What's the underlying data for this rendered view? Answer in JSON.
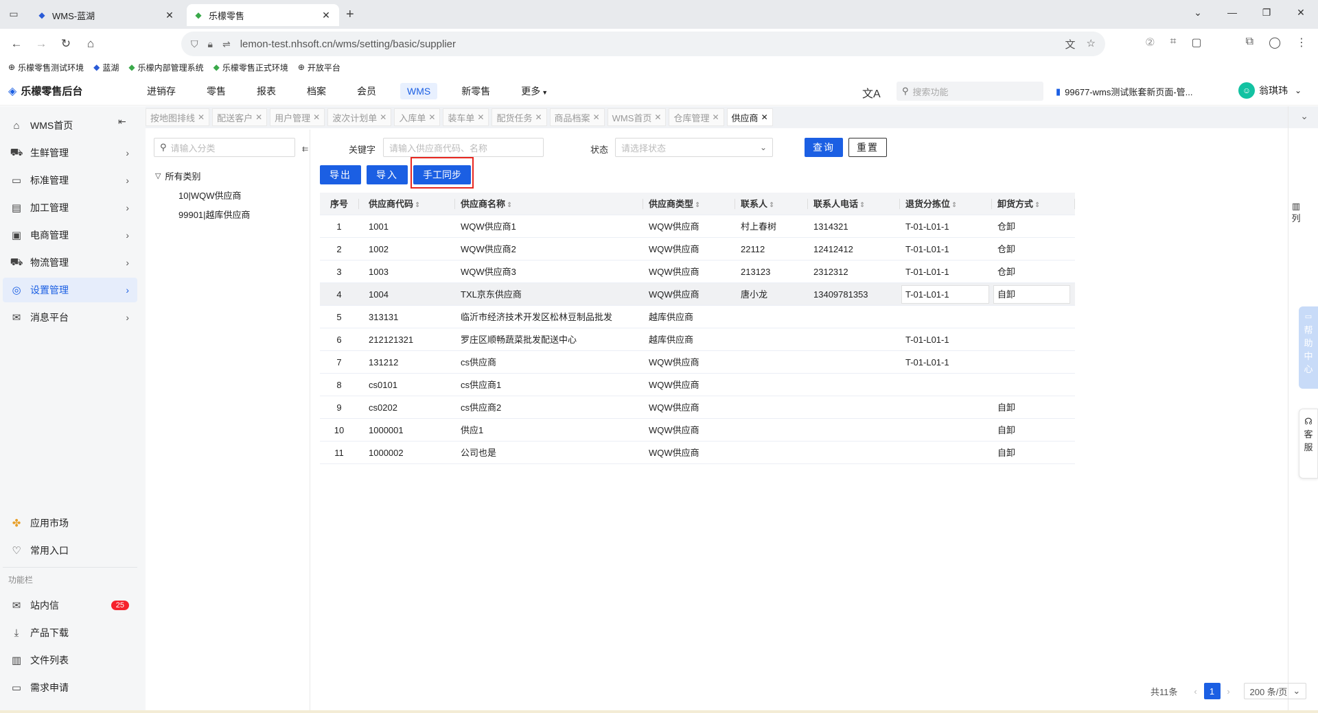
{
  "browser": {
    "tabs": [
      {
        "title": "WMS-蓝湖",
        "active": false
      },
      {
        "title": "乐檬零售",
        "active": true
      }
    ],
    "url": "lemon-test.nhsoft.cn/wms/setting/basic/supplier",
    "bookmarks": [
      "乐檬零售测试环境",
      "蓝湖",
      "乐檬内部管理系统",
      "乐檬零售正式环境",
      "开放平台"
    ]
  },
  "app": {
    "logo": "乐檬零售后台",
    "topnav": [
      "进销存",
      "零售",
      "报表",
      "档案",
      "会员",
      "WMS",
      "新零售",
      "更多"
    ],
    "active_topnav": "WMS",
    "search_placeholder": "搜索功能",
    "account": "99677-wms测试账套新页面-管...",
    "user": "翁琪玮"
  },
  "sidebar": {
    "items": [
      {
        "label": "WMS首页",
        "icon": "home-icon"
      },
      {
        "label": "生鲜管理",
        "icon": "fresh-icon"
      },
      {
        "label": "标准管理",
        "icon": "standard-icon"
      },
      {
        "label": "加工管理",
        "icon": "process-icon"
      },
      {
        "label": "电商管理",
        "icon": "ecommerce-icon"
      },
      {
        "label": "物流管理",
        "icon": "logistics-icon"
      },
      {
        "label": "设置管理",
        "icon": "settings-icon",
        "active": true
      },
      {
        "label": "消息平台",
        "icon": "message-icon"
      }
    ],
    "bottom_items": [
      {
        "label": "应用市场",
        "icon": "app-market-icon"
      },
      {
        "label": "常用入口",
        "icon": "heart-icon"
      }
    ],
    "section_label": "功能栏",
    "function_items": [
      {
        "label": "站内信",
        "icon": "mail-icon",
        "badge": "25"
      },
      {
        "label": "产品下载",
        "icon": "download-icon"
      },
      {
        "label": "文件列表",
        "icon": "file-list-icon"
      },
      {
        "label": "需求申请",
        "icon": "request-icon"
      }
    ]
  },
  "page_tabs": [
    "按地图排线",
    "配送客户",
    "用户管理",
    "波次计划单",
    "入库单",
    "装车单",
    "配货任务",
    "商品档案",
    "WMS首页",
    "仓库管理",
    "供应商"
  ],
  "active_page_tab": "供应商",
  "tree": {
    "search_placeholder": "请输入分类",
    "root": "所有类别",
    "children": [
      "10|WQW供应商",
      "99901|越库供应商"
    ]
  },
  "filters": {
    "keyword_label": "关键字",
    "keyword_placeholder": "请输入供应商代码、名称",
    "status_label": "状态",
    "status_placeholder": "请选择状态",
    "query_button": "查询",
    "reset_button": "重置"
  },
  "actions": {
    "export": "导出",
    "import": "导入",
    "sync": "手工同步"
  },
  "table": {
    "columns": [
      "序号",
      "供应商代码",
      "供应商名称",
      "供应商类型",
      "联系人",
      "联系人电话",
      "退货分拣位",
      "卸货方式"
    ],
    "rows": [
      [
        "1",
        "1001",
        "WQW供应商1",
        "WQW供应商",
        "村上春树",
        "1314321",
        "T-01-L01-1",
        "仓卸"
      ],
      [
        "2",
        "1002",
        "WQW供应商2",
        "WQW供应商",
        "22112",
        "12412412",
        "T-01-L01-1",
        "仓卸"
      ],
      [
        "3",
        "1003",
        "WQW供应商3",
        "WQW供应商",
        "213123",
        "2312312",
        "T-01-L01-1",
        "仓卸"
      ],
      [
        "4",
        "1004",
        "TXL京东供应商",
        "WQW供应商",
        "唐小龙",
        "13409781353",
        "T-01-L01-1",
        "自卸"
      ],
      [
        "5",
        "313131",
        "临沂市经济技术开发区松林豆制品批发",
        "越库供应商",
        "",
        "",
        "",
        ""
      ],
      [
        "6",
        "212121321",
        "罗庄区顺畅蔬菜批发配送中心",
        "越库供应商",
        "",
        "",
        "T-01-L01-1",
        ""
      ],
      [
        "7",
        "131212",
        "cs供应商",
        "WQW供应商",
        "",
        "",
        "T-01-L01-1",
        ""
      ],
      [
        "8",
        "cs0101",
        "cs供应商1",
        "WQW供应商",
        "",
        "",
        "",
        ""
      ],
      [
        "9",
        "cs0202",
        "cs供应商2",
        "WQW供应商",
        "",
        "",
        "",
        "自卸"
      ],
      [
        "10",
        "1000001",
        "供应1",
        "WQW供应商",
        "",
        "",
        "",
        "自卸"
      ],
      [
        "11",
        "1000002",
        "公司也是",
        "WQW供应商",
        "",
        "",
        "",
        "自卸"
      ]
    ]
  },
  "right_tools": {
    "columns": "列",
    "help": "帮助中心",
    "service": "客服"
  },
  "pager": {
    "total": "共11条",
    "current": "1",
    "page_size": "200 条/页"
  }
}
